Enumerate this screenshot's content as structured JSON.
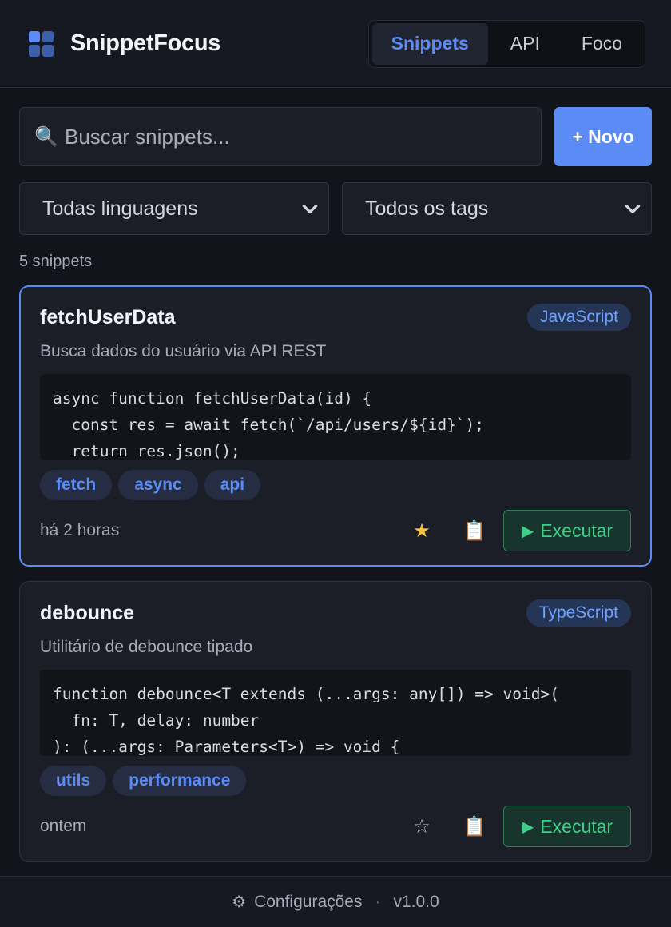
{
  "header": {
    "brand": "SnippetFocus",
    "tabs": [
      {
        "label": "Snippets",
        "active": true
      },
      {
        "label": "API",
        "active": false
      },
      {
        "label": "Foco",
        "active": false
      }
    ]
  },
  "toolbar": {
    "search_icon": "🔍",
    "search_placeholder": "Buscar snippets...",
    "new_label": "+ Novo",
    "language_filter": "Todas linguagens",
    "tag_filter": "Todos os tags",
    "count_text": "5 snippets"
  },
  "snippets": [
    {
      "title": "fetchUserData",
      "language": "JavaScript",
      "description": "Busca dados do usuário via API REST",
      "code": "async function fetchUserData(id) {\n  const res = await fetch(`/api/users/${id}`);\n  return res.json();",
      "tags": [
        "fetch",
        "async",
        "api"
      ],
      "time": "há 2 horas",
      "favorite_glyph": "★",
      "copy_glyph": "📋",
      "run_glyph": "▶",
      "run_label": "Executar"
    },
    {
      "title": "debounce",
      "language": "TypeScript",
      "description": "Utilitário de debounce tipado",
      "code": "function debounce<T extends (...args: any[]) => void>(\n  fn: T, delay: number\n): (...args: Parameters<T>) => void {",
      "tags": [
        "utils",
        "performance"
      ],
      "time": "ontem",
      "favorite_glyph": "☆",
      "copy_glyph": "📋",
      "run_glyph": "▶",
      "run_label": "Executar"
    }
  ],
  "footer": {
    "gear_glyph": "⚙",
    "settings_label": "Configurações",
    "separator": "·",
    "version": "v1.0.0"
  },
  "colors": {
    "accent": "#5b8cf5",
    "run_green": "#3ed08a",
    "star_gold": "#f5c542",
    "background": "#12141b"
  }
}
